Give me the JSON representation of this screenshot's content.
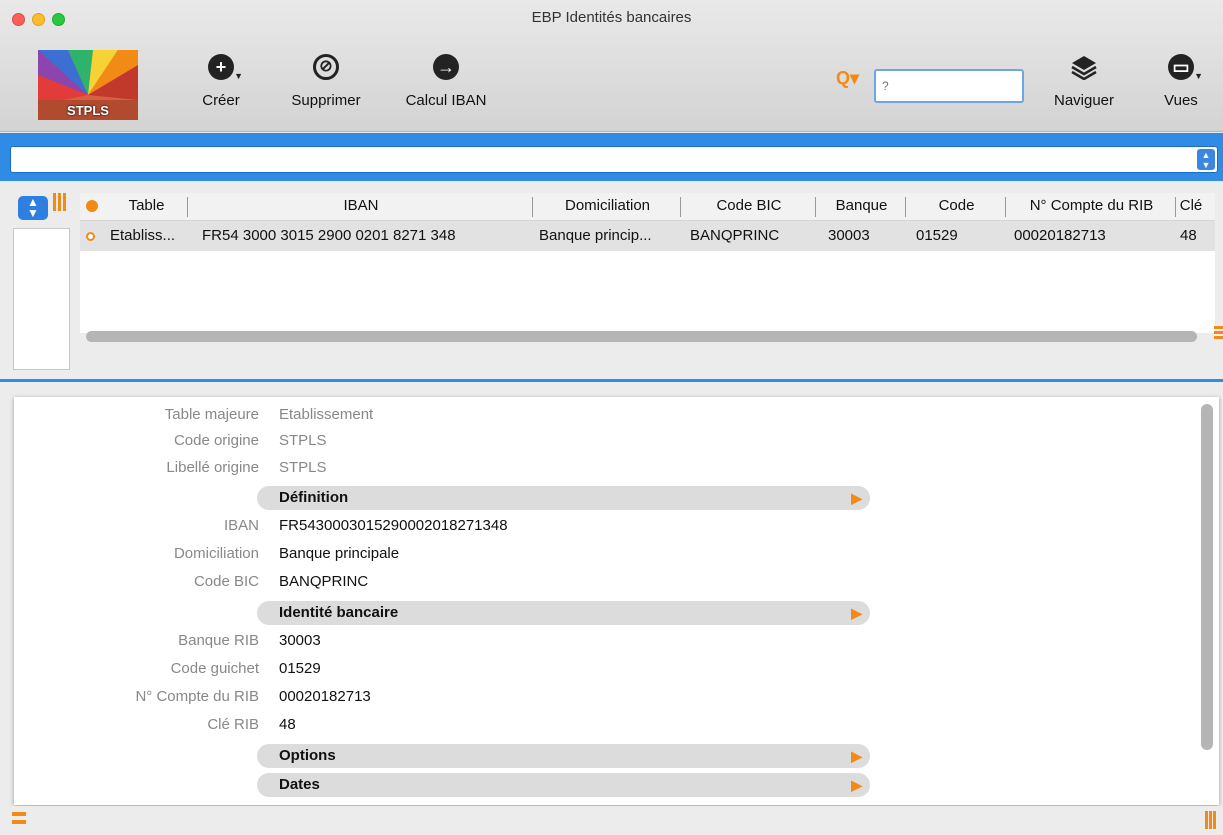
{
  "window": {
    "title": "EBP Identités bancaires"
  },
  "logo": {
    "label": "STPLS"
  },
  "toolbar": {
    "create_label": "Créer",
    "delete_label": "Supprimer",
    "iban_label": "Calcul IBAN",
    "navigate_label": "Naviguer",
    "views_label": "Vues",
    "search_placeholder": "?"
  },
  "grid": {
    "columns": [
      "Table",
      "IBAN",
      "Domiciliation",
      "Code BIC",
      "Banque",
      "Code",
      "N° Compte du RIB",
      "Clé"
    ],
    "rows": [
      [
        "Etabliss...",
        "FR54 3000 3015 2900 0201 8271 348",
        "Banque princip...",
        "BANQPRINC",
        "30003",
        "01529",
        "00020182713",
        "48"
      ]
    ]
  },
  "detail": {
    "table_majeure": {
      "label": "Table majeure",
      "value": "Etablissement"
    },
    "code_origine": {
      "label": "Code origine",
      "value": "STPLS"
    },
    "libelle_origine": {
      "label": "Libellé origine",
      "value": "STPLS"
    },
    "section_definition": "Définition",
    "iban": {
      "label": "IBAN",
      "value": "FR5430003015290002018271348"
    },
    "domiciliation": {
      "label": "Domiciliation",
      "value": "Banque principale"
    },
    "code_bic": {
      "label": "Code BIC",
      "value": "BANQPRINC"
    },
    "section_identite": "Identité bancaire",
    "banque_rib": {
      "label": "Banque RIB",
      "value": "30003"
    },
    "code_guichet": {
      "label": "Code guichet",
      "value": "01529"
    },
    "compte_rib": {
      "label": "N° Compte du RIB",
      "value": "00020182713"
    },
    "cle_rib": {
      "label": "Clé RIB",
      "value": "48"
    },
    "section_options": "Options",
    "section_dates": "Dates"
  },
  "colors": {
    "accent_blue": "#2f8be3",
    "accent_orange": "#f28a16"
  }
}
